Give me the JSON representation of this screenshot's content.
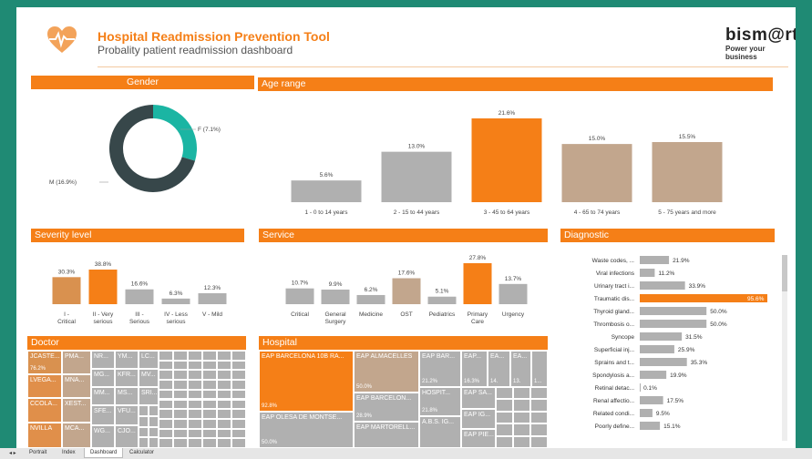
{
  "header": {
    "title": "Hospital Readmission Prevention Tool",
    "subtitle": "Probality patient readmission dashboard",
    "brand": "bism@rt",
    "brand_tagline": "Power your business",
    "logo_icon": "heart-pulse-icon",
    "accent_color": "#f57f17"
  },
  "gender": {
    "title": "Gender",
    "label_f": "F (7.1%)",
    "label_m": "M (16.9%)",
    "chart_data": {
      "type": "pie",
      "donut": true,
      "slices": [
        {
          "name": "F",
          "value": 7.1,
          "color": "#1bb5a3"
        },
        {
          "name": "M",
          "value": 16.9,
          "color": "#37474a"
        }
      ]
    }
  },
  "age": {
    "title": "Age range",
    "chart_data": {
      "type": "bar",
      "categories": [
        "1 - 0 to 14 years",
        "2 - 15 to 44 years",
        "3 - 45 to 64 years",
        "4 - 65 to 74 years",
        "5 - 75 years and more"
      ],
      "values": [
        5.6,
        13.0,
        21.6,
        15.0,
        15.5
      ],
      "labels": [
        "5.6%",
        "13.0%",
        "21.6%",
        "15.0%",
        "15.5%"
      ],
      "colors": [
        "#b0b0b0",
        "#b0b0b0",
        "#f57f17",
        "#c2a68d",
        "#c2a68d"
      ]
    }
  },
  "severity": {
    "title": "Severity level",
    "chart_data": {
      "type": "bar",
      "categories": [
        "I - Critical",
        "II - Very serious",
        "III - Serious",
        "IV - Less serious",
        "V - Mild"
      ],
      "values": [
        30.3,
        38.8,
        16.6,
        6.3,
        12.3
      ],
      "labels": [
        "30.3%",
        "38.8%",
        "16.6%",
        "6.3%",
        "12.3%"
      ],
      "colors": [
        "#d9914f",
        "#f57f17",
        "#b0b0b0",
        "#b0b0b0",
        "#b0b0b0"
      ]
    }
  },
  "service": {
    "title": "Service",
    "chart_data": {
      "type": "bar",
      "categories": [
        "Critical",
        "General Surgery",
        "Medicine",
        "OST",
        "Pediatrics",
        "Primary Care",
        "Urgency"
      ],
      "values": [
        10.7,
        9.9,
        6.2,
        17.6,
        5.1,
        27.8,
        13.7
      ],
      "labels": [
        "10.7%",
        "9.9%",
        "6.2%",
        "17.6%",
        "5.1%",
        "27.8%",
        "13.7%"
      ],
      "colors": [
        "#b0b0b0",
        "#b0b0b0",
        "#b0b0b0",
        "#c2a68d",
        "#b0b0b0",
        "#f57f17",
        "#b0b0b0"
      ]
    }
  },
  "diagnostic": {
    "title": "Diagnostic",
    "chart_data": {
      "type": "bar",
      "orientation": "horizontal",
      "categories": [
        "Waste codes, ...",
        "Viral infections",
        "Urinary tract i...",
        "Traumatic dis...",
        "Thyroid gland...",
        "Thrombosis o...",
        "Syncope",
        "Superficial inj...",
        "Sprains and t...",
        "Spondylosis a...",
        "Retinal detac...",
        "Renal affectio...",
        "Related condi...",
        "Poorly define..."
      ],
      "values": [
        21.9,
        11.2,
        33.9,
        95.6,
        50.0,
        50.0,
        31.5,
        25.9,
        35.3,
        19.9,
        0.1,
        17.5,
        9.5,
        15.1
      ],
      "labels": [
        "21.9%",
        "11.2%",
        "33.9%",
        "95.6%",
        "50.0%",
        "50.0%",
        "31.5%",
        "25.9%",
        "35.3%",
        "19.9%",
        "0.1%",
        "17.5%",
        "9.5%",
        "15.1%"
      ],
      "highlight_index": 3
    }
  },
  "doctor": {
    "title": "Doctor",
    "cells": [
      "JCASTE...",
      "PMA...",
      "NR...",
      "YM...",
      "LC...",
      "LVEGA...",
      "MNA...",
      "MG...",
      "KFR...",
      "MV...",
      "MM...",
      "MS...",
      "SRI...",
      "CCOLA...",
      "XEST...",
      "VFU...",
      "SFE...",
      "NVILLA",
      "MCA...",
      "CJO...",
      "WG..."
    ],
    "first_pct": "76.2%"
  },
  "hospital": {
    "title": "Hospital",
    "cells": [
      "EAP BARCELONA 10B RA...",
      "EAP ALMACELLES",
      "EAP BAR...",
      "EAP...",
      "EA...",
      "EA...",
      "EAP OLESA DE MONTSE...",
      "EAP BARCELON...",
      "HOSPIT...",
      "EAP SA...",
      "EAP IG...",
      "EAP MARTORELL...",
      "A.B.S. IG...",
      "EAP PIE..."
    ],
    "pcts": [
      "92.8%",
      "50.0%",
      "21.2%",
      "16.3%",
      "14.",
      "13.",
      "1...",
      "28.9%",
      "21.8%",
      "50.0%"
    ]
  },
  "tabs": [
    "Portrait",
    "Index",
    "Dashboard",
    "Calculator"
  ],
  "active_tab": "Dashboard"
}
